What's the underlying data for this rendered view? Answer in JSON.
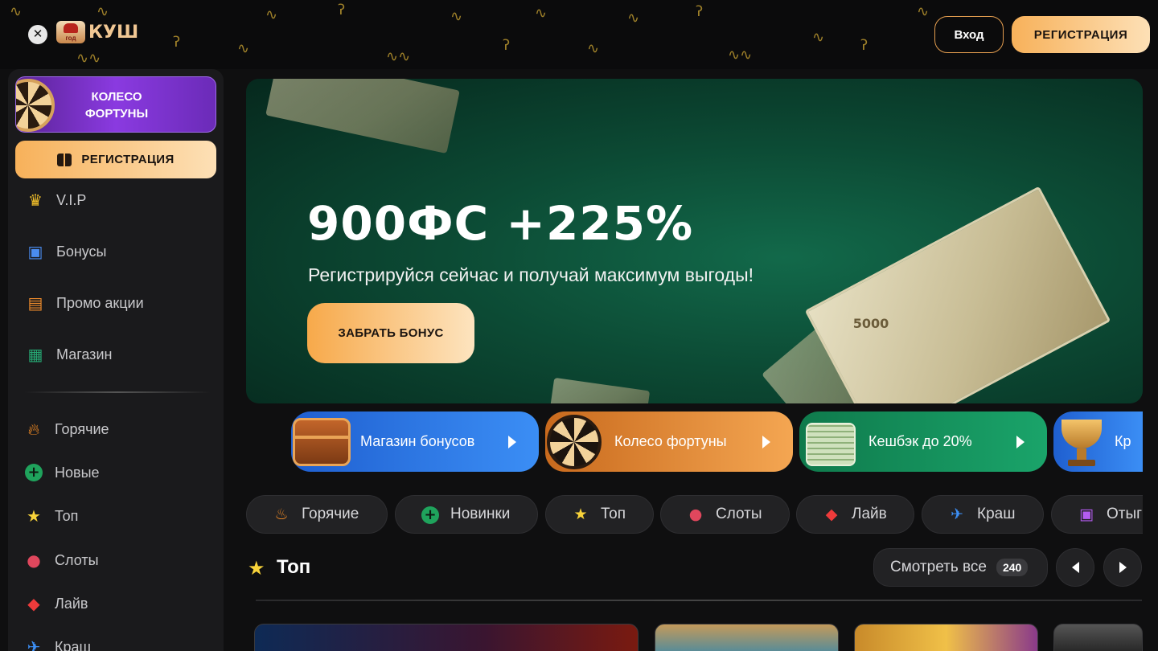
{
  "header": {
    "logo_badge_text": "год",
    "logo_text": "КУШ",
    "login_label": "Вход",
    "register_label": "РЕГИСТРАЦИЯ"
  },
  "sidebar": {
    "wheel_label": "КОЛЕСО ФОРТУНЫ",
    "register_label": "РЕГИСТРАЦИЯ",
    "menu": [
      {
        "label": "V.I.P",
        "icon": "crown-icon"
      },
      {
        "label": "Бонусы",
        "icon": "gift-icon"
      },
      {
        "label": "Промо акции",
        "icon": "promo-icon"
      },
      {
        "label": "Магазин",
        "icon": "shop-icon"
      }
    ],
    "categories": [
      {
        "label": "Горячие",
        "icon": "fire-icon"
      },
      {
        "label": "Новые",
        "icon": "plus-icon"
      },
      {
        "label": "Топ",
        "icon": "star-icon"
      },
      {
        "label": "Слоты",
        "icon": "cherry-icon"
      },
      {
        "label": "Лайв",
        "icon": "live-icon"
      },
      {
        "label": "Краш",
        "icon": "plane-icon"
      }
    ]
  },
  "banner": {
    "title": "900ФС +225%",
    "subtitle": "Регистрируйся сейчас и получай максимум выгоды!",
    "cta_label": "ЗАБРАТЬ БОНУС",
    "bill_value": "5000"
  },
  "promos": [
    {
      "label": "Магазин бонусов",
      "color": "#2f7ff0"
    },
    {
      "label": "Колесо фортуны",
      "color": "#e98a2c"
    },
    {
      "label": "Кешбэк до 20%",
      "color": "#17915f"
    },
    {
      "label": "Кр",
      "color": "#2f7ff0"
    }
  ],
  "chips": [
    {
      "label": "Горячие",
      "icon": "fire-icon"
    },
    {
      "label": "Новинки",
      "icon": "plus-icon"
    },
    {
      "label": "Топ",
      "icon": "star-icon"
    },
    {
      "label": "Слоты",
      "icon": "cherry-icon"
    },
    {
      "label": "Лайв",
      "icon": "live-icon"
    },
    {
      "label": "Краш",
      "icon": "plane-icon"
    },
    {
      "label": "Отыг",
      "icon": "gift-icon"
    }
  ],
  "section": {
    "title": "Топ",
    "see_all_label": "Смотреть все",
    "count": "240"
  },
  "colors": {
    "accent_orange": "#f7b15a",
    "background": "#0f0f10",
    "sidebar": "#1a1a1c"
  }
}
